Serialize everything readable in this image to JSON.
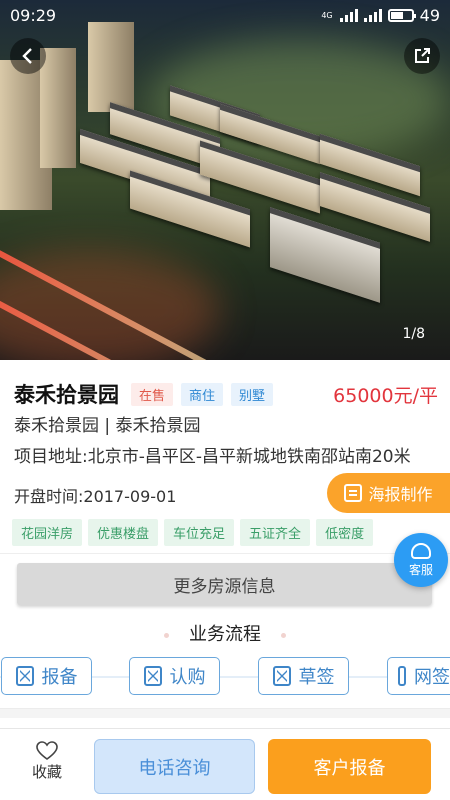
{
  "status_bar": {
    "time": "09:29",
    "network": "4G",
    "battery": "49"
  },
  "hero": {
    "image_counter": "1/8",
    "back_icon": "back-arrow-icon",
    "share_icon": "share-icon"
  },
  "project": {
    "name": "泰禾拾景园",
    "sale_status": "在售",
    "types": [
      "商住",
      "别墅"
    ],
    "price": "65000元/平",
    "subtitle": "泰禾拾景园 | 泰禾拾景园",
    "address": "项目地址:北京市-昌平区-昌平新城地铁南邵站南20米",
    "open_date": "开盘时间:2017-09-01"
  },
  "poster_button": {
    "label": "海报制作"
  },
  "features": [
    "花园洋房",
    "优惠楼盘",
    "车位充足",
    "五证齐全",
    "低密度"
  ],
  "service_button": {
    "label": "客服"
  },
  "more_button": {
    "label": "更多房源信息"
  },
  "process": {
    "title": "业务流程",
    "steps": [
      "报备",
      "认购",
      "草签",
      "网签"
    ]
  },
  "bottom_bar": {
    "favorite_label": "收藏",
    "call_label": "电话咨询",
    "report_label": "客户报备"
  },
  "colors": {
    "accent_blue": "#2c9cf4",
    "price_red": "#e2353d",
    "orange": "#fb9f1d",
    "feature_green": "#3a9e68"
  }
}
